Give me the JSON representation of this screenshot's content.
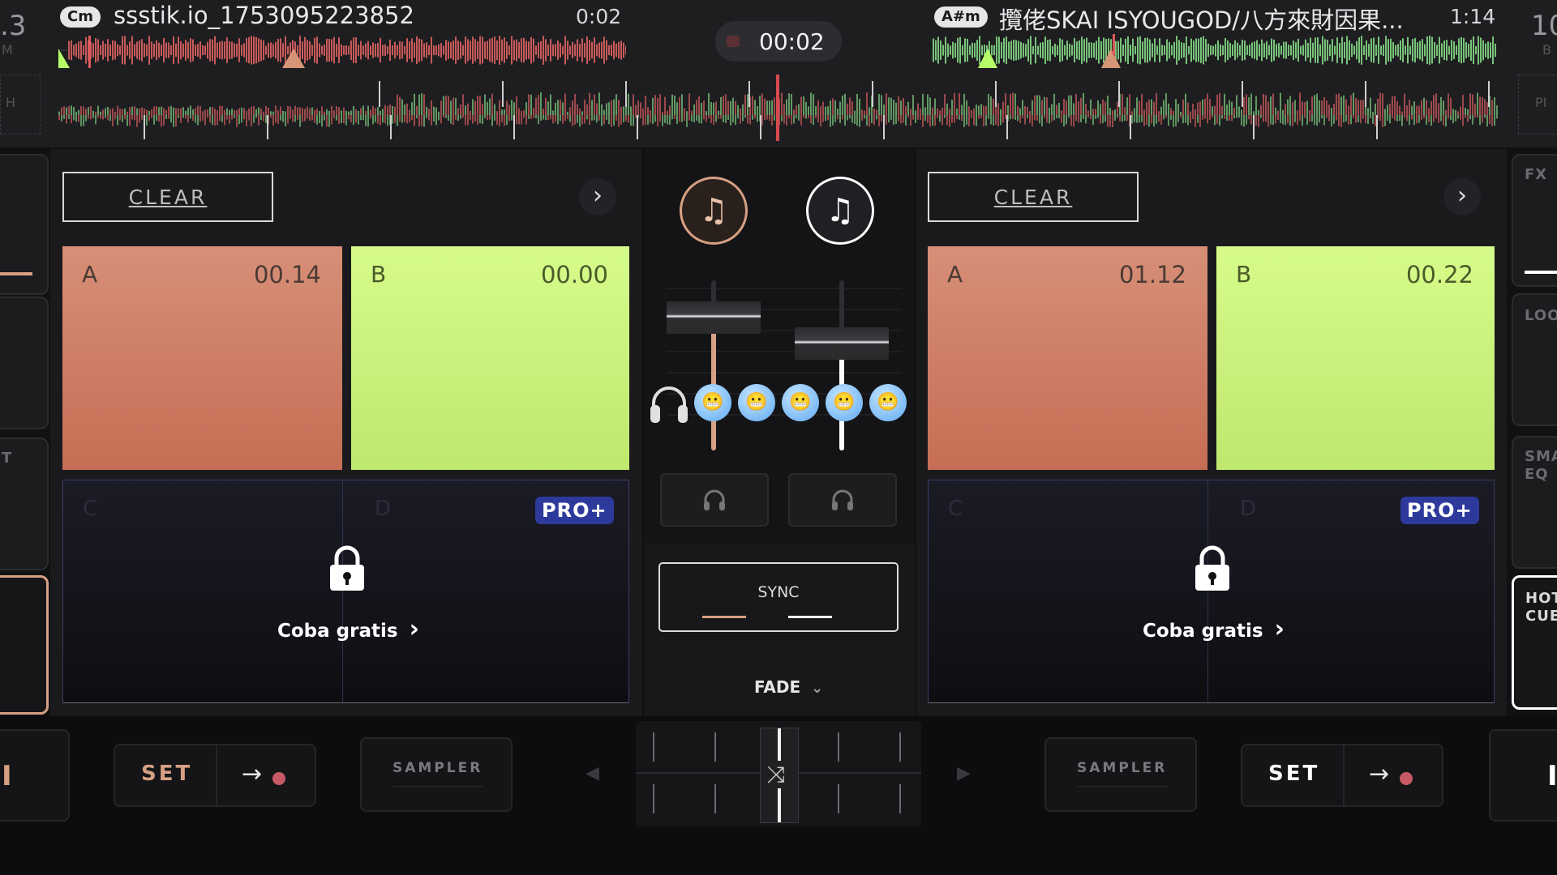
{
  "left_edge": {
    "number": ".3",
    "sub_top": "M",
    "sub_mid": "H"
  },
  "right_edge": {
    "number": "10",
    "sub_top": "B",
    "sub_mid": "PI"
  },
  "deck_left": {
    "key": "Cm",
    "title": "ssstik.io_1753095223852",
    "time": "0:02",
    "clear_label": "CLEAR",
    "next_icon": "›",
    "pads": [
      {
        "letter": "A",
        "time": "00.14"
      },
      {
        "letter": "B",
        "time": "00.00"
      }
    ],
    "locked": {
      "letter_c": "C",
      "letter_d": "D",
      "badge": "PRO+",
      "cta": "Coba gratis",
      "cta_icon": "›"
    },
    "set_label": "SET",
    "sampler_label": "SAMPLER"
  },
  "deck_right": {
    "key": "A#m",
    "title": "攬佬SKAI ISYOUGOD/八方來財因果...",
    "time": "1:14",
    "clear_label": "CLEAR",
    "next_icon": "›",
    "pads": [
      {
        "letter": "A",
        "time": "01.12"
      },
      {
        "letter": "B",
        "time": "00.22"
      }
    ],
    "locked": {
      "letter_c": "C",
      "letter_d": "D",
      "badge": "PRO+",
      "cta": "Coba gratis",
      "cta_icon": "›"
    },
    "set_label": "SET",
    "sampler_label": "SAMPLER"
  },
  "timer": "00:02",
  "mixer": {
    "music_icon": "♫",
    "headphone_icon": "🎧",
    "sync_label": "SYNC",
    "fade_label": "FADE",
    "fade_icon": "⌄",
    "crossfader_icon": "⤨",
    "emoji_glyph": "😬",
    "left_fader_level": 0.85,
    "right_fader_level": 0.66,
    "crossfader_position": 0.5
  },
  "right_side_panel": {
    "fx": "FX",
    "loop": "LOO",
    "smart_eq_1": "SMA",
    "smart_eq_2": "EQ",
    "hot_cue_1": "HOT",
    "hot_cue_2": "CUE"
  },
  "left_side_panel": {
    "label": "T"
  },
  "bottom": {
    "left_edge_glyph": "I",
    "right_edge_glyph": "I",
    "prev_arrow": "◀",
    "next_arrow": "▶",
    "arrow_glyph": "→"
  },
  "colors": {
    "deck_left_accent": "#d7a083",
    "deck_right_accent": "#ffffff",
    "pad_a": "#d08068",
    "pad_b": "#cdf57f",
    "pro_badge": "#2d3a9c",
    "waveform_red": "#c85a5a",
    "waveform_green": "#79c37a"
  }
}
